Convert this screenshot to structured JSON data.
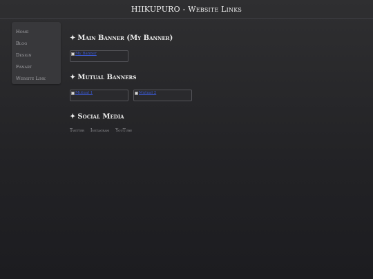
{
  "header": {
    "title": "HIIKUPURO - Website Links"
  },
  "sidebar": {
    "items": [
      {
        "label": "Home"
      },
      {
        "label": "Blog"
      },
      {
        "label": "Design"
      },
      {
        "label": "Fanart"
      },
      {
        "label": "Website Link"
      }
    ]
  },
  "sections": {
    "main_banner": {
      "title": "Main Banner (My Banner)",
      "star_icon": "✦",
      "banners": [
        {
          "alt": "My Banner"
        }
      ]
    },
    "mutual_banners": {
      "title": "Mutual Banners",
      "star_icon": "✦",
      "banners": [
        {
          "alt": "Mutual 1"
        },
        {
          "alt": "Mutual 2"
        }
      ]
    },
    "social_media": {
      "title": "Social Media",
      "star_icon": "✦",
      "links": [
        {
          "label": "Twitter"
        },
        {
          "label": "Instagram"
        },
        {
          "label": "YouTube"
        }
      ]
    }
  }
}
